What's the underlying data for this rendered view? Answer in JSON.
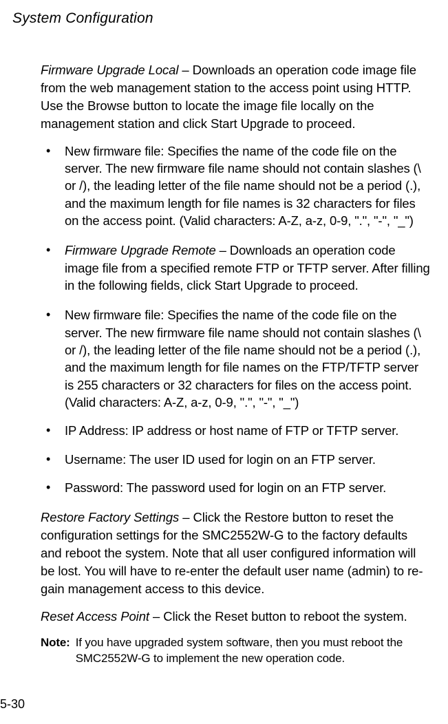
{
  "header": "System Configuration",
  "firmware_local": {
    "term": "Firmware Upgrade Local",
    "desc": " – Downloads an operation code image file from the web management station to the access point using HTTP. Use the Browse button to locate the image file locally on the management station and click Start Upgrade to proceed."
  },
  "bullets1": {
    "b0": "New firmware file: Specifies the name of the code file on the server. The new firmware file name should not contain slashes (\\ or /), the leading letter of the file name should not be a period (.), and the maximum length for file names is 32 characters for files on the access point. (Valid characters: A-Z, a-z, 0-9, \".\", \"-\", \"_\")"
  },
  "bullets2": {
    "term": "Firmware Upgrade Remote",
    "desc": " – Downloads an operation code image file from a specified remote FTP or TFTP server. After filling in the following fields, click Start Upgrade to proceed."
  },
  "bullets3": {
    "b0": "New firmware file: Specifies the name of the code file on the server. The new firmware file name should not contain slashes (\\ or /), the leading letter of the file name should not be a period (.), and the maximum length for file names on the FTP/TFTP server is 255 characters or 32 characters for files on the access point. (Valid characters: A-Z, a-z, 0-9, \".\", \"-\", \"_\")",
    "b1": "IP Address: IP address or host name of FTP or TFTP server.",
    "b2": "Username: The user ID used for login on an FTP server.",
    "b3": "Password: The password used for login on an FTP server."
  },
  "restore": {
    "term": "Restore Factory Settings",
    "desc": " – Click the Restore button to reset the configuration settings for the SMC2552W-G to the factory defaults and reboot the system. Note that all user configured information will be lost. You will have to re-enter the default user name (admin) to re-gain management access to this device."
  },
  "reset": {
    "term": "Reset Access Point",
    "desc": " – Click the Reset button to reboot the system."
  },
  "note": {
    "label": "Note:",
    "text": "If you have upgraded system software, then you must reboot the SMC2552W-G to implement the new operation code."
  },
  "page": "5-30"
}
